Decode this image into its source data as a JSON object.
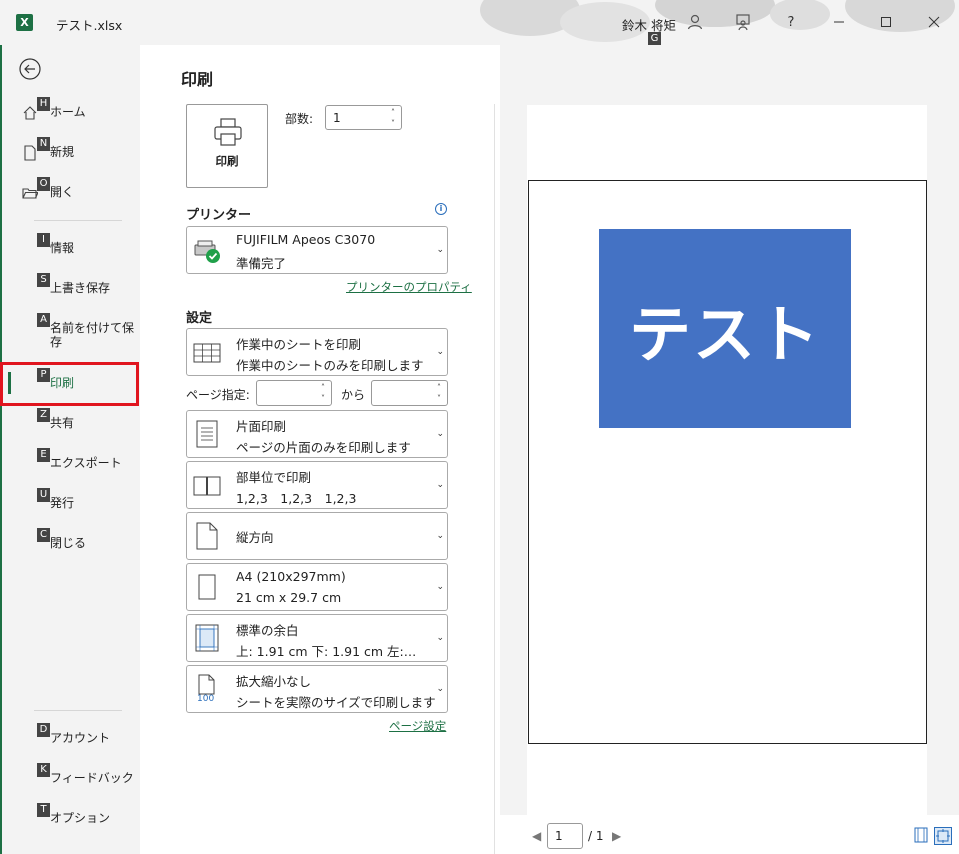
{
  "app": {
    "file_title": "テスト.xlsx",
    "user_name": "鈴木 将矩",
    "user_keytip": "G",
    "help_label": "?"
  },
  "sidebar": {
    "items": [
      {
        "key": "H",
        "label": "ホーム",
        "icon": "home-icon"
      },
      {
        "key": "N",
        "label": "新規",
        "icon": "new-document-icon"
      },
      {
        "key": "O",
        "label": "開く",
        "icon": "open-folder-icon"
      },
      {
        "key": "I",
        "label": "情報",
        "icon": ""
      },
      {
        "key": "S",
        "label": "上書き保存",
        "icon": ""
      },
      {
        "key": "A",
        "label": "名前を付けて保存",
        "icon": ""
      },
      {
        "key": "P",
        "label": "印刷",
        "icon": ""
      },
      {
        "key": "Z",
        "label": "共有",
        "icon": ""
      },
      {
        "key": "E",
        "label": "エクスポート",
        "icon": ""
      },
      {
        "key": "U",
        "label": "発行",
        "icon": ""
      },
      {
        "key": "C",
        "label": "閉じる",
        "icon": ""
      },
      {
        "key": "D",
        "label": "アカウント",
        "icon": ""
      },
      {
        "key": "K",
        "label": "フィードバック",
        "icon": ""
      },
      {
        "key": "T",
        "label": "オプション",
        "icon": ""
      }
    ],
    "active": "印刷"
  },
  "print": {
    "title": "印刷",
    "print_button_label": "印刷",
    "copies_label": "部数:",
    "copies_value": "1",
    "printer_section": "プリンター",
    "printer_name": "FUJIFILM Apeos C3070",
    "printer_status": "準備完了",
    "printer_properties_link": "プリンターのプロパティ",
    "settings_section": "設定",
    "what_to_print": {
      "title": "作業中のシートを印刷",
      "desc": "作業中のシートのみを印刷します"
    },
    "pages_label": "ページ指定:",
    "pages_from": "",
    "pages_to_label": "から",
    "pages_to": "",
    "sides": {
      "title": "片面印刷",
      "desc": "ページの片面のみを印刷します"
    },
    "collation": {
      "title": "部単位で印刷",
      "desc": "1,2,3　1,2,3　1,2,3"
    },
    "orientation": {
      "title": "縦方向"
    },
    "paper": {
      "title": "A4 (210x297mm)",
      "desc": "21 cm x 29.7 cm"
    },
    "margins": {
      "title": "標準の余白",
      "desc": "上: 1.91 cm 下: 1.91 cm 左:…"
    },
    "scaling": {
      "title": "拡大縮小なし",
      "desc": "シートを実際のサイズで印刷します",
      "icon_text": "100"
    },
    "page_setup_link": "ページ設定"
  },
  "preview": {
    "shape_text": "テスト",
    "shape_color": "#4472c4",
    "current_page": "1",
    "total_pages": "/ 1"
  }
}
